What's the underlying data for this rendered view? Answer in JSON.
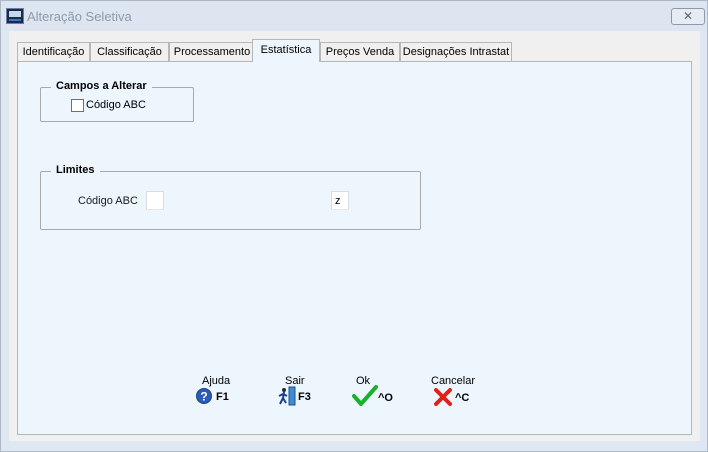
{
  "window": {
    "title": "Alteração Seletiva",
    "close_label": "✕"
  },
  "tabs": [
    {
      "label": "Identificação",
      "active": false
    },
    {
      "label": "Classificação",
      "active": false
    },
    {
      "label": "Processamento",
      "active": false
    },
    {
      "label": "Estatística",
      "active": true
    },
    {
      "label": "Preços Venda",
      "active": false
    },
    {
      "label": "Designações Intrastat",
      "active": false
    }
  ],
  "campos_group": {
    "legend": "Campos a Alterar",
    "checkbox_label": "Código ABC",
    "checked": false
  },
  "limites_group": {
    "legend": "Limites",
    "field_label": "Código ABC",
    "from_value": "",
    "to_value": "z"
  },
  "function_keys": [
    {
      "caption": "Ajuda",
      "key": "F1",
      "icon": "help-icon"
    },
    {
      "caption": "Sair",
      "key": "F3",
      "icon": "exit-icon"
    },
    {
      "caption": "Ok",
      "key": "^O",
      "icon": "checkmark-icon"
    },
    {
      "caption": "Cancelar",
      "key": "^C",
      "icon": "cancel-x-icon"
    }
  ],
  "colors": {
    "ok_green": "#19b02a",
    "cancel_red": "#e0211b",
    "help_blue": "#2a5bb8",
    "panel_bg": "#eef6fd"
  }
}
